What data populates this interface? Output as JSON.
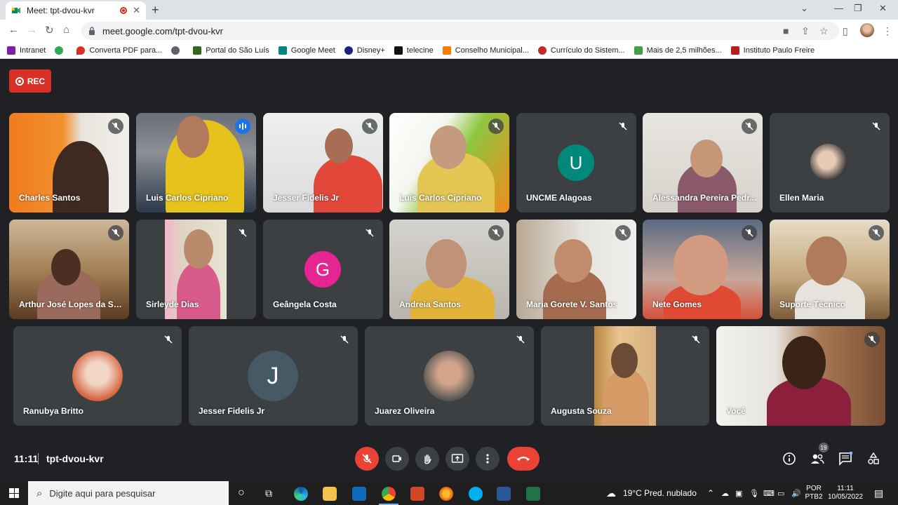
{
  "browser": {
    "tab_title": "Meet: tpt-dvou-kvr",
    "url": "meet.google.com/tpt-dvou-kvr",
    "bookmarks": [
      {
        "label": "Intranet",
        "color": "#7b1fa2"
      },
      {
        "label": "",
        "color": "#34a853"
      },
      {
        "label": "Converta PDF para...",
        "color": "#d93025"
      },
      {
        "label": "",
        "color": "#5f6368"
      },
      {
        "label": "Portal do São Luís",
        "color": "#5f6368"
      },
      {
        "label": "Google Meet",
        "color": "#00897b"
      },
      {
        "label": "Disney+",
        "color": "#1a237e"
      },
      {
        "label": "telecine",
        "color": "#111111"
      },
      {
        "label": "Conselho Municipal...",
        "color": "#f57c00"
      },
      {
        "label": "Currículo do Sistem...",
        "color": "#c62828"
      },
      {
        "label": "Mais de 2,5 milhões...",
        "color": "#43a047"
      },
      {
        "label": "Instituto Paulo Freire",
        "color": "#b71c1c"
      }
    ]
  },
  "meeting": {
    "rec_label": "REC",
    "time": "11:11",
    "code": "tpt-dvou-kvr",
    "participants_count": "19"
  },
  "participants": [
    {
      "name": "Charles Santos"
    },
    {
      "name": "Luis Carlos Cipriano"
    },
    {
      "name": "Jesser Fidelis Jr"
    },
    {
      "name": "Luis Carlos Cipriano"
    },
    {
      "name": "UNCME Alagoas",
      "initial": "U"
    },
    {
      "name": "Alessandra Pereira Pedr..."
    },
    {
      "name": "Ellen Maria"
    },
    {
      "name": "Arthur José Lopes da Sil..."
    },
    {
      "name": "Sirleyde Dias"
    },
    {
      "name": "Geângela Costa",
      "initial": "G"
    },
    {
      "name": "Andreia Santos"
    },
    {
      "name": "Maria Gorete V. Santos"
    },
    {
      "name": "Nete Gomes"
    },
    {
      "name": "Suporte Técnico"
    },
    {
      "name": "Ranubya Britto"
    },
    {
      "name": "Jesser Fidelis Jr",
      "initial": "J"
    },
    {
      "name": "Juarez Oliveira"
    },
    {
      "name": "Augusta Souza"
    },
    {
      "name": "Você"
    }
  ],
  "taskbar": {
    "search_placeholder": "Digite aqui para pesquisar",
    "weather": "19°C  Pred. nublado",
    "lang_top": "POR",
    "lang_bottom": "PTB2",
    "clock_time": "11:11",
    "clock_date": "10/05/2022"
  }
}
